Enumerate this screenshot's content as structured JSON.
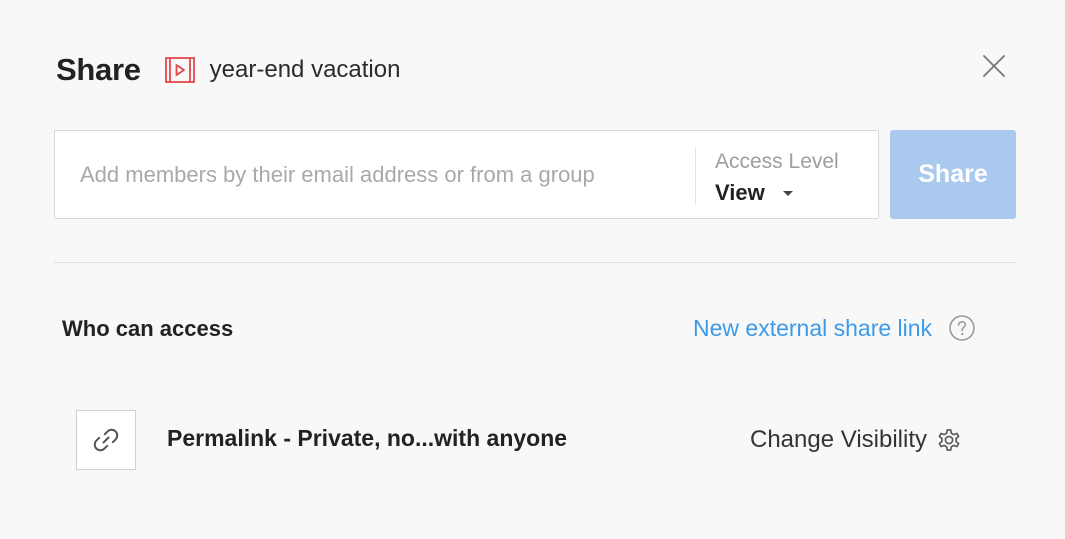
{
  "header": {
    "title": "Share",
    "item_name": "year-end vacation",
    "item_icon": "video-icon",
    "item_icon_color": "#e0484a"
  },
  "invite": {
    "placeholder": "Add members by their email address or from a group",
    "value": "",
    "access_level_label": "Access Level",
    "access_level_value": "View"
  },
  "share_button": {
    "label": "Share",
    "color": "#a9caee"
  },
  "access_section": {
    "title": "Who can access",
    "external_link_label": "New external share link",
    "external_link_color": "#3d9ae8"
  },
  "permalink": {
    "icon": "link-icon",
    "label": "Permalink - Private, no...with anyone",
    "visibility_label": "Change Visibility",
    "visibility_icon": "gear-icon"
  }
}
